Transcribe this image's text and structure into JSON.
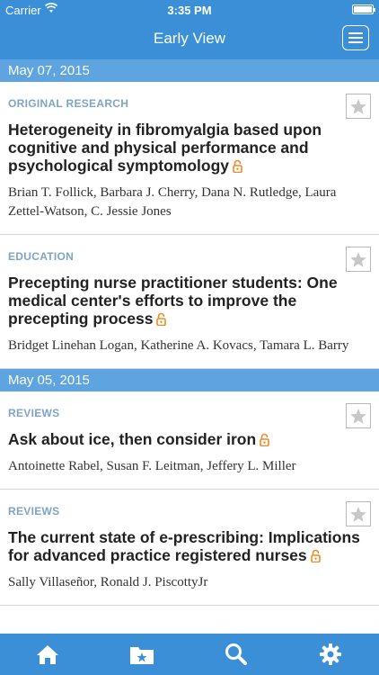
{
  "status_bar": {
    "carrier": "Carrier",
    "time": "3:35 PM"
  },
  "nav": {
    "title": "Early View",
    "menu_icon": "hamburger-menu-icon"
  },
  "sections": [
    {
      "date": "May 07, 2015",
      "articles": [
        {
          "category": "ORIGINAL RESEARCH",
          "title": "Heterogeneity in fibromyalgia based upon cognitive and physical performance and psychological symptomology",
          "authors": "Brian T. Follick, Barbara J. Cherry, Dana N. Rutledge, Laura Zettel-Watson, C. Jessie Jones"
        },
        {
          "category": "EDUCATION",
          "title": "Precepting nurse practitioner students: One medical center's efforts to improve the precepting process",
          "authors": "Bridget Linehan Logan, Katherine A. Kovacs, Tamara L. Barry"
        }
      ]
    },
    {
      "date": "May 05, 2015",
      "articles": [
        {
          "category": "REVIEWS",
          "title": "Ask about ice, then consider iron",
          "authors": "Antoinette Rabel, Susan F. Leitman, Jeffery L. Miller"
        },
        {
          "category": "REVIEWS",
          "title": "The current state of e-prescribing: Implications for advanced practice registered nurses",
          "authors": "Sally Villaseñor, Ronald J. PiscottyJr"
        }
      ]
    }
  ],
  "tab_bar": {
    "tabs": [
      "home-icon",
      "saved-folder-icon",
      "search-icon",
      "settings-gear-icon"
    ]
  },
  "colors": {
    "brand_blue": "#3a8fd6",
    "date_header_blue": "#5da4e0",
    "category_text": "#7ea4c7",
    "open_access_orange": "#f08a24"
  }
}
